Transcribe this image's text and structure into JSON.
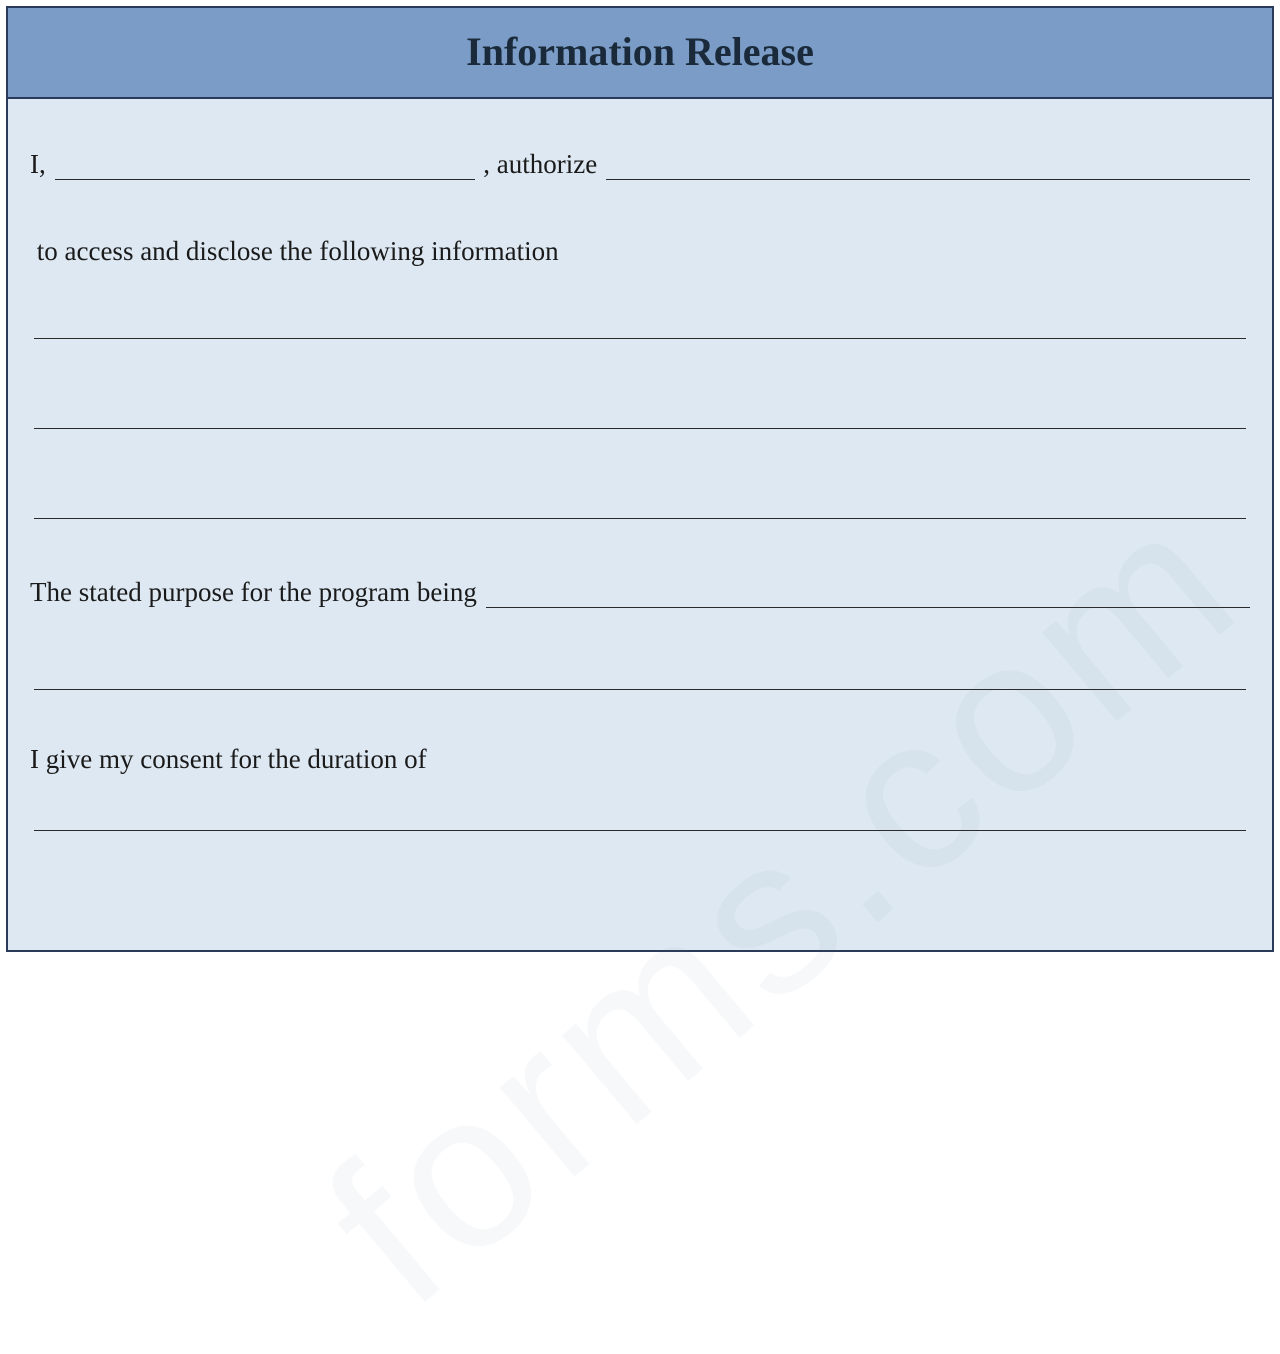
{
  "header": {
    "title": "Information Release"
  },
  "form": {
    "line1_part1": "I, ",
    "line1_part2": " , authorize ",
    "line2": " to access and disclose the following information",
    "line3": "The stated purpose for the program being ",
    "line4": "I give my consent for the duration of"
  },
  "watermark": "forms.com"
}
